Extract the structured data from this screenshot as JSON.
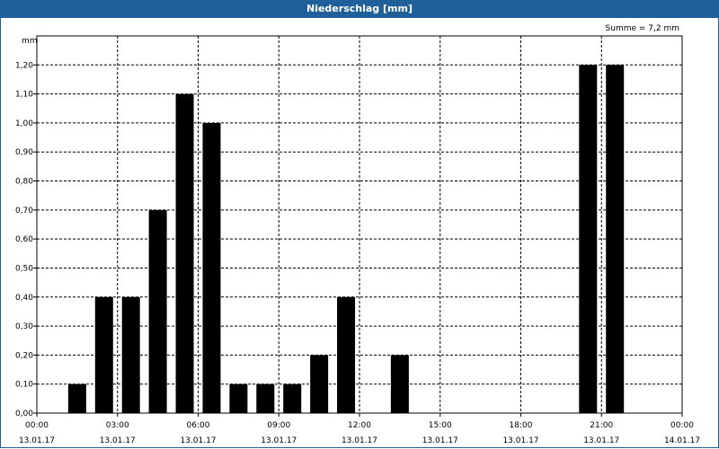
{
  "window": {
    "title": "Niederschlag [mm]"
  },
  "chart_data": {
    "type": "bar",
    "title": "Niederschlag [mm]",
    "ylabel": "mm",
    "ylim": [
      0,
      1.3
    ],
    "yticks": [
      "0,00",
      "0,10",
      "0,20",
      "0,30",
      "0,40",
      "0,50",
      "0,60",
      "0,70",
      "0,80",
      "0,90",
      "1,00",
      "1,10",
      "1,20"
    ],
    "xlim_hours": [
      0,
      24
    ],
    "xticks": [
      {
        "time": "00:00",
        "date": "13.01.17"
      },
      {
        "time": "03:00",
        "date": "13.01.17"
      },
      {
        "time": "06:00",
        "date": "13.01.17"
      },
      {
        "time": "09:00",
        "date": "13.01.17"
      },
      {
        "time": "12:00",
        "date": "13.01.17"
      },
      {
        "time": "15:00",
        "date": "13.01.17"
      },
      {
        "time": "18:00",
        "date": "13.01.17"
      },
      {
        "time": "21:00",
        "date": "13.01.17"
      },
      {
        "time": "00:00",
        "date": "14.01.17"
      }
    ],
    "x_hours": [
      1.5,
      2.5,
      3.5,
      4.5,
      5.5,
      6.5,
      7.5,
      8.5,
      9.5,
      10.5,
      11.5,
      12.5,
      13.5,
      14.5,
      15.5,
      16.5,
      17.5,
      18.5,
      19.5,
      20.5,
      21.5
    ],
    "values": [
      0.1,
      0.4,
      0.4,
      0.7,
      1.1,
      1.0,
      0.1,
      0.1,
      0.1,
      0.2,
      0.4,
      0.0,
      0.2,
      0.0,
      0.0,
      0.0,
      0.0,
      0.0,
      0.0,
      1.2,
      1.2
    ],
    "annotation": "Summe = 7,2 mm",
    "bar_color": "#000000",
    "grid": true
  }
}
